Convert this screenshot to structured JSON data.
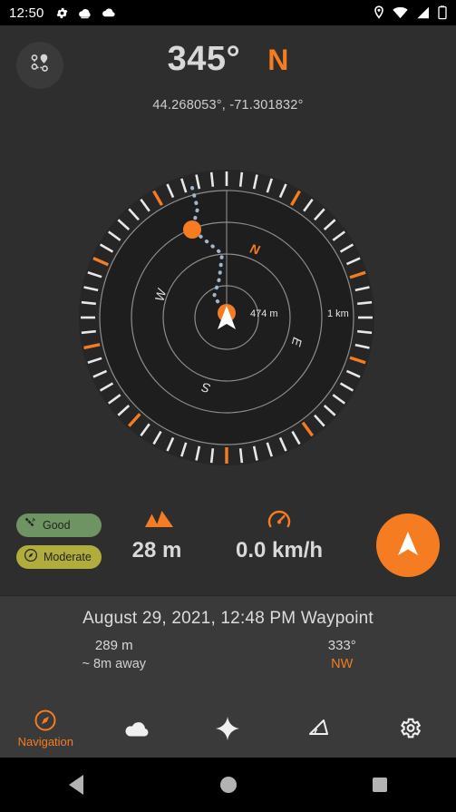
{
  "statusbar": {
    "time": "12:50",
    "left_icons": [
      "gear-icon",
      "cloud-filled-icon",
      "cloud-icon"
    ],
    "right_icons": [
      "location-pin-icon",
      "wifi-icon",
      "cellular-signal-icon",
      "battery-icon"
    ]
  },
  "header": {
    "route_button_icon": "route-waypoints-icon",
    "bearing_degrees": "345°",
    "bearing_direction": "N",
    "coordinates": "44.268053°,  -71.301832°"
  },
  "compass": {
    "ring_labels": {
      "inner": "474 m",
      "outer": "1 km"
    },
    "cardinals": {
      "n": "N",
      "e": "E",
      "s": "S",
      "w": "W"
    },
    "heading_degrees": 345,
    "waypoint_count": 2
  },
  "metrics": {
    "badges": [
      {
        "label": "Good",
        "icon": "satellite-icon",
        "color": "#6e9463"
      },
      {
        "label": "Moderate",
        "icon": "compass-icon",
        "color": "#b0ad3d"
      }
    ],
    "altitude": {
      "icon": "mountain-icon",
      "value": "28 m"
    },
    "speed": {
      "icon": "speedometer-icon",
      "value": "0.0 km/h"
    },
    "fab_icon": "navigation-arrow-icon"
  },
  "waypoint": {
    "title": "August 29, 2021, 12:48 PM Waypoint",
    "left": {
      "primary": "289 m",
      "secondary": "~ 8m away"
    },
    "right": {
      "primary": "333°",
      "secondary": "NW"
    }
  },
  "bottomnav": {
    "items": [
      {
        "label": "Navigation",
        "icon": "compass-icon",
        "active": true
      },
      {
        "label": "",
        "icon": "cloud-icon",
        "active": false
      },
      {
        "label": "",
        "icon": "star-sparkle-icon",
        "active": false
      },
      {
        "label": "",
        "icon": "angle-icon",
        "active": false
      },
      {
        "label": "",
        "icon": "gear-icon",
        "active": false
      }
    ]
  },
  "androidbar": {
    "items": [
      "back-button",
      "home-button",
      "recents-button"
    ]
  },
  "colors": {
    "accent": "#F57C20",
    "background": "#2e2e2e",
    "panel": "#3a3a3a",
    "text": "#d8d8d8"
  }
}
